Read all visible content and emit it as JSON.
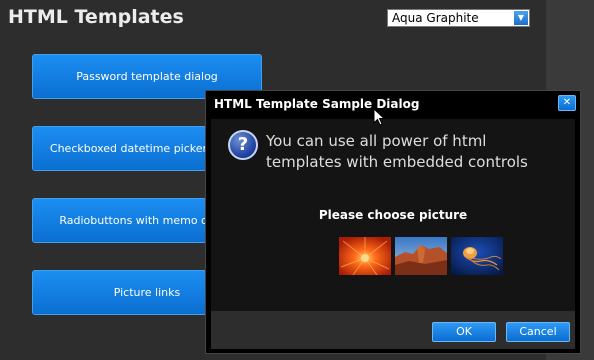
{
  "app": {
    "title": "HTML Templates"
  },
  "theme_select": {
    "value": "Aqua Graphite"
  },
  "buttons": [
    {
      "label": "Password template dialog"
    },
    {
      "label": "Checkboxed datetime picker dialog"
    },
    {
      "label": "Radiobuttons with memo dialog"
    },
    {
      "label": "Picture links"
    }
  ],
  "dialog": {
    "title": "HTML Template Sample Dialog",
    "message": "You can use all power of html templates with embedded controls",
    "choose_label": "Please choose picture",
    "pictures": [
      "flower-thumbnail",
      "desert-thumbnail",
      "jellyfish-thumbnail"
    ],
    "ok_label": "OK",
    "cancel_label": "Cancel"
  },
  "colors": {
    "accent": "#1d8ef2",
    "background": "#2d2d2d",
    "dialog_bg": "#000000"
  }
}
